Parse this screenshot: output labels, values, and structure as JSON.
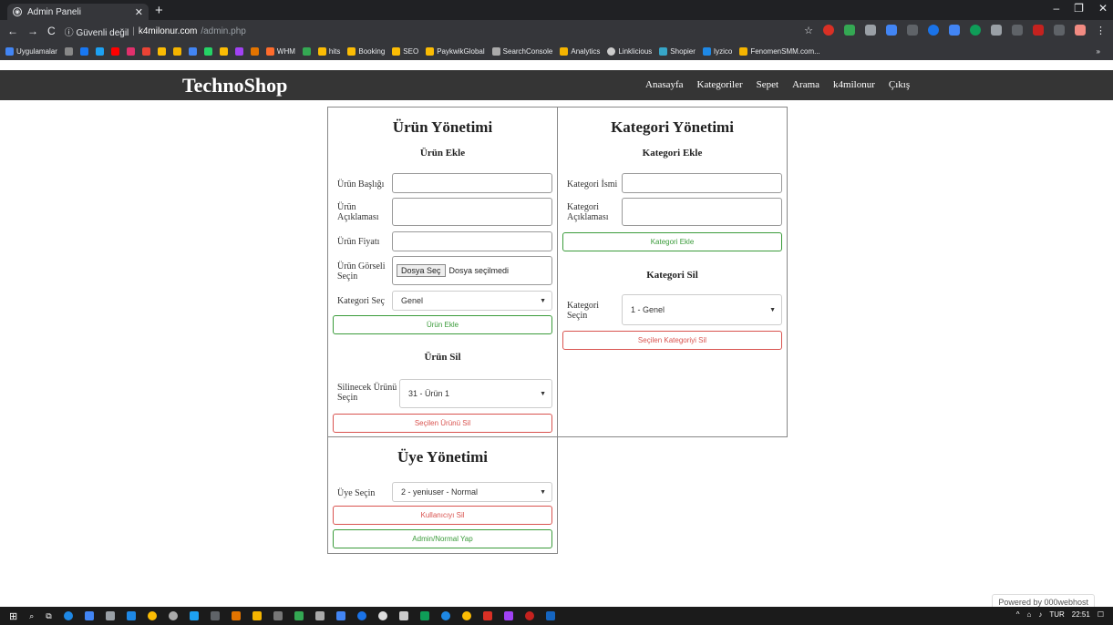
{
  "browser": {
    "tab_title": "Admin Paneli",
    "new_tab": "+",
    "window_controls": [
      "–",
      "❐",
      "✕"
    ],
    "nav": {
      "back": "←",
      "forward": "→",
      "reload": "C"
    },
    "security": "ⓘ Güvenli değil",
    "host": "k4milonur.com",
    "path": "/admin.php",
    "bookmarks": [
      {
        "label": "Uygulamalar",
        "color": "#4285f4"
      },
      {
        "label": "WHM",
        "color": "#ff6c2c"
      },
      {
        "label": "hits",
        "color": "#fbbc04"
      },
      {
        "label": "Booking",
        "color": "#fbbc04"
      },
      {
        "label": "SEO",
        "color": "#fbbc04"
      },
      {
        "label": "PaykwikGlobal",
        "color": "#fbbc04"
      },
      {
        "label": "SearchConsole",
        "color": "#aaaaaa"
      },
      {
        "label": "Analytics",
        "color": "#f4b400"
      },
      {
        "label": "Linklicious",
        "color": "#cccccc"
      },
      {
        "label": "Shopier",
        "color": "#37a6c8"
      },
      {
        "label": "Iyzico",
        "color": "#1e88e5"
      },
      {
        "label": "FenomenSMM.com...",
        "color": "#f4b400"
      }
    ],
    "bookmarks_more": "»"
  },
  "site": {
    "brand": "TechnoShop",
    "menu": [
      "Anasayfa",
      "Kategoriler",
      "Sepet",
      "Arama",
      "k4milonur",
      "Çıkış"
    ]
  },
  "product_panel": {
    "title": "Ürün Yönetimi",
    "add_heading": "Ürün Ekle",
    "label_title": "Ürün Başlığı",
    "label_desc": "Ürün Açıklaması",
    "label_price": "Ürün Fiyatı",
    "label_image": "Ürün Görseli Seçin",
    "file_button": "Dosya Seç",
    "file_status": "Dosya seçilmedi",
    "label_category": "Kategori Seç",
    "category_value": "Genel",
    "add_button": "Ürün Ekle",
    "delete_heading": "Ürün Sil",
    "label_delete": "Silinecek Ürünü Seçin",
    "delete_value": "31 - Ürün 1",
    "delete_button": "Seçilen Ürünü Sil"
  },
  "category_panel": {
    "title": "Kategori Yönetimi",
    "add_heading": "Kategori Ekle",
    "label_name": "Kategori İsmi",
    "label_desc": "Kategori Açıklaması",
    "add_button": "Kategori Ekle",
    "delete_heading": "Kategori Sil",
    "label_select": "Kategori Seçin",
    "select_value": "1 - Genel",
    "delete_button": "Seçilen Kategoriyi Sil"
  },
  "user_panel": {
    "title": "Üye Yönetimi",
    "label_select": "Üye Seçin",
    "select_value": "2 - yeniuser - Normal",
    "delete_button": "Kullanıcıyı Sil",
    "toggle_button": "Admin/Normal Yap"
  },
  "powered_by": "Powered by 000webhost",
  "taskbar": {
    "lang": "TUR",
    "time": "22:51"
  }
}
